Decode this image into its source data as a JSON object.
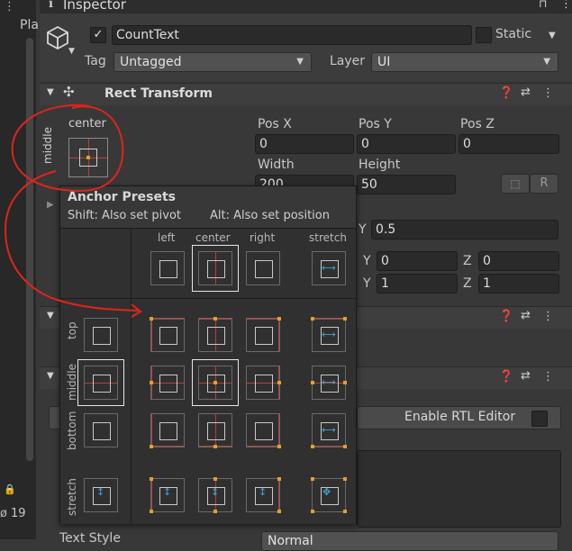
{
  "window": {
    "tab_title": "Inspector",
    "left_tab": "Pla",
    "left_count": "19"
  },
  "gameobject": {
    "active_checked": true,
    "name": "CountText",
    "static_label": "Static",
    "tag_label": "Tag",
    "tag_value": "Untagged",
    "layer_label": "Layer",
    "layer_value": "UI"
  },
  "rect_transform": {
    "title": "Rect Transform",
    "anchor_h": "center",
    "anchor_v": "middle",
    "pos_x_label": "Pos X",
    "pos_x": "0",
    "pos_y_label": "Pos Y",
    "pos_y": "0",
    "pos_z_label": "Pos Z",
    "pos_z": "0",
    "width_label": "Width",
    "width": "200",
    "height_label": "Height",
    "height": "50",
    "r_button": "R",
    "pivot_y_label": "Y",
    "pivot_y": "0.5",
    "rot_y_label": "Y",
    "rot_y": "0",
    "rot_z_label": "Z",
    "rot_z": "0",
    "scale_y_label": "Y",
    "scale_y": "1",
    "scale_z_label": "Z",
    "scale_z": "1"
  },
  "text_component": {
    "rtl_label": "Enable RTL Editor",
    "text_style_label": "Text Style",
    "text_style_value": "Normal"
  },
  "anchor_presets": {
    "title": "Anchor Presets",
    "hint_left": "Shift: Also set pivot",
    "hint_right": "Alt: Also set position",
    "columns": [
      "left",
      "center",
      "right",
      "stretch"
    ],
    "rows": [
      "top",
      "middle",
      "bottom",
      "stretch"
    ],
    "selected": "middle-center"
  },
  "colors": {
    "background": "#383838",
    "header": "#3e3e3e",
    "field": "#2a2a2a",
    "anchor_dot": "#e1a320",
    "anchor_line": "#b8403b",
    "stretch_arrow": "#3aa6d8",
    "annotation": "#e0241b"
  }
}
